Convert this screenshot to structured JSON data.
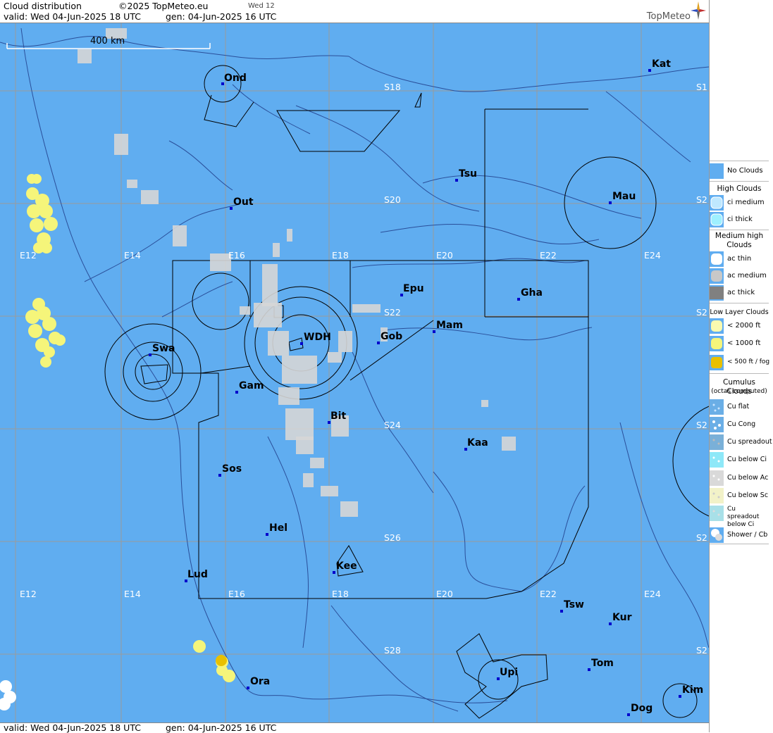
{
  "header": {
    "title": "Cloud distribution",
    "copyright": "©2025 TopMeteo.eu",
    "day_code": "Wed 12",
    "valid_text": "valid:  Wed  04-Jun-2025  18 UTC",
    "gen_text": "gen: 04-Jun-2025 16 UTC",
    "brand": "TopMeteo"
  },
  "footer": {
    "valid_text": "valid:  Wed  04-Jun-2025  18 UTC",
    "gen_text": "gen: 04-Jun-2025 16 UTC"
  },
  "map": {
    "scale_label": "400 km",
    "colors": {
      "background": "#60adf0",
      "grid": "#9a9a9a",
      "low_cloud": "#f5f57a",
      "cu_below_ac": "#d8d8d8",
      "border": "#000000"
    },
    "places": [
      {
        "name": "Ond"
      },
      {
        "name": "Kat"
      },
      {
        "name": "Tsu"
      },
      {
        "name": "Out"
      },
      {
        "name": "Mau"
      },
      {
        "name": "Epu"
      },
      {
        "name": "Gha"
      },
      {
        "name": "Mam"
      },
      {
        "name": "Swa"
      },
      {
        "name": "WDH"
      },
      {
        "name": "Gob"
      },
      {
        "name": "Gam"
      },
      {
        "name": "Bit"
      },
      {
        "name": "Kaa"
      },
      {
        "name": "Sos"
      },
      {
        "name": "Hel"
      },
      {
        "name": "Lud"
      },
      {
        "name": "Kee"
      },
      {
        "name": "Tsw"
      },
      {
        "name": "Kur"
      },
      {
        "name": "Tom"
      },
      {
        "name": "Upi"
      },
      {
        "name": "Ora"
      },
      {
        "name": "Dog"
      },
      {
        "name": "Kim"
      }
    ],
    "grid_labels": [
      "E12",
      "E14",
      "E16",
      "E18",
      "E20",
      "E22",
      "E24",
      "S18",
      "S20",
      "S22",
      "S24",
      "S26",
      "S28"
    ],
    "edge_labels": [
      "S1",
      "S2"
    ]
  },
  "legend": {
    "no_clouds": "No Clouds",
    "high_title": "High Clouds",
    "ci_medium": "ci medium",
    "ci_thick": "ci thick",
    "medium_title": "Medium high Clouds",
    "ac_thin": "ac thin",
    "ac_medium": "ac medium",
    "ac_thick": "ac thick",
    "low_title": "Low Layer Clouds",
    "low_2000": "< 2000 ft",
    "low_1000": "< 1000 ft",
    "low_500": "< 500 ft / fog",
    "cu_title": "Cumulus Clouds",
    "cu_sub": "(octas computed)",
    "cu_flat": "Cu flat",
    "cu_cong": "Cu Cong",
    "cu_spreadout": "Cu spreadout",
    "cu_below_ci": "Cu below Ci",
    "cu_below_ac": "Cu below Ac",
    "cu_below_sc": "Cu below Sc",
    "cu_spreadout_below_ci": "Cu spreadout below Ci",
    "shower_cb": "Shower / Cb"
  }
}
